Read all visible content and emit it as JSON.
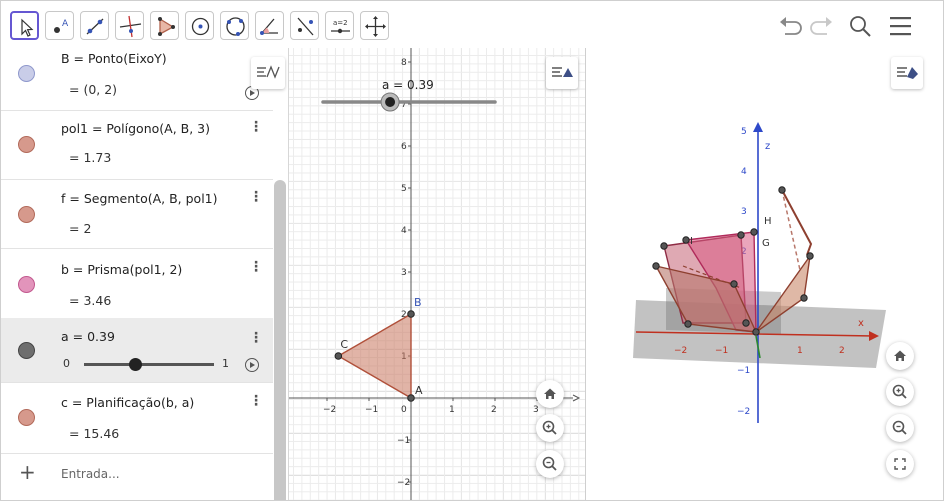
{
  "toolbar": {
    "tools": [
      "move-tool",
      "point-tool",
      "segment-tool",
      "perpendicular-line-tool",
      "polygon-tool",
      "circle-center-point-tool",
      "circle-through-three-points-tool",
      "angle-tool",
      "reflect-about-line-tool",
      "slider-tool",
      "move-graphics-view-tool"
    ],
    "slider_tool_label": "a=2"
  },
  "algebra": {
    "rows": [
      {
        "def": "B = Ponto(EixoY)",
        "value": "= (0, 2)",
        "color": "#c9cde8"
      },
      {
        "def": "pol1 = Polígono(A, B, 3)",
        "value": "= 1.73",
        "color": "#d6998c"
      },
      {
        "def": "f = Segmento(A, B, pol1)",
        "value": "= 2",
        "color": "#d6998c"
      },
      {
        "def": "b = Prisma(pol1, 2)",
        "value": "= 3.46",
        "color": "#e294bb"
      },
      {
        "def": "a = 0.39",
        "value": "",
        "color": "#6e6e6e",
        "slider_min": "0",
        "slider_max": "1",
        "slider_fraction": 0.39
      },
      {
        "def": "c = Planificação(b, a)",
        "value": "= 15.46",
        "color": "#d6998c"
      }
    ],
    "input_placeholder": "Entrada..."
  },
  "graphics2d": {
    "slider_caption": "a = 0.39",
    "slider_fraction": 0.39,
    "x_ticks": [
      "−2",
      "−1",
      "0",
      "1",
      "2",
      "3"
    ],
    "y_ticks": [
      "8",
      "7",
      "6",
      "5",
      "4",
      "3",
      "2",
      "1",
      "−1",
      "−2"
    ],
    "points": [
      {
        "name": "A",
        "x": 0,
        "y": 0
      },
      {
        "name": "B",
        "x": 0,
        "y": 2
      },
      {
        "name": "C",
        "x": -1.73,
        "y": 1
      }
    ],
    "polygon_color": "#c8775f"
  },
  "graphics3d": {
    "x_label": "x",
    "z_label": "z",
    "x_ticks": [
      "−2",
      "−1",
      "1",
      "2"
    ],
    "z_ticks": [
      "5",
      "4",
      "3",
      "2",
      "−1",
      "−2"
    ],
    "vertex_labels": [
      "H",
      "G",
      "I"
    ]
  }
}
